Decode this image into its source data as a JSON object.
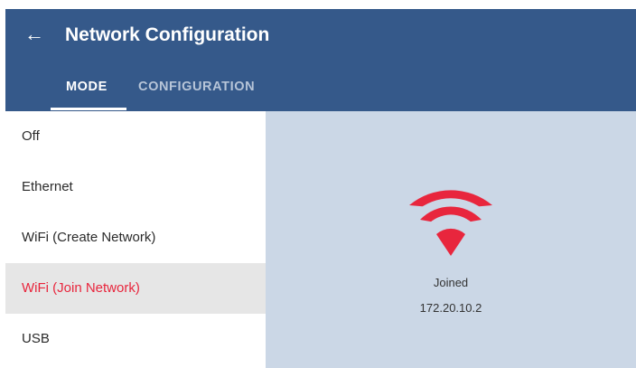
{
  "header": {
    "back_icon": "arrow-left-icon",
    "title": "Network Configuration",
    "tabs": [
      {
        "label": "MODE",
        "active": true
      },
      {
        "label": "CONFIGURATION",
        "active": false
      }
    ]
  },
  "mode_list": {
    "items": [
      {
        "label": "Off",
        "selected": false
      },
      {
        "label": "Ethernet",
        "selected": false
      },
      {
        "label": "WiFi (Create Network)",
        "selected": false
      },
      {
        "label": "WiFi (Join Network)",
        "selected": true
      },
      {
        "label": "USB",
        "selected": false
      }
    ]
  },
  "status": {
    "icon": "wifi-icon",
    "state": "Joined",
    "ip_address": "172.20.10.2"
  },
  "colors": {
    "app_bar": "#35598a",
    "accent": "#e8263d",
    "selected_row": "#e6e6e6",
    "status_panel": "#cbd7e6"
  }
}
